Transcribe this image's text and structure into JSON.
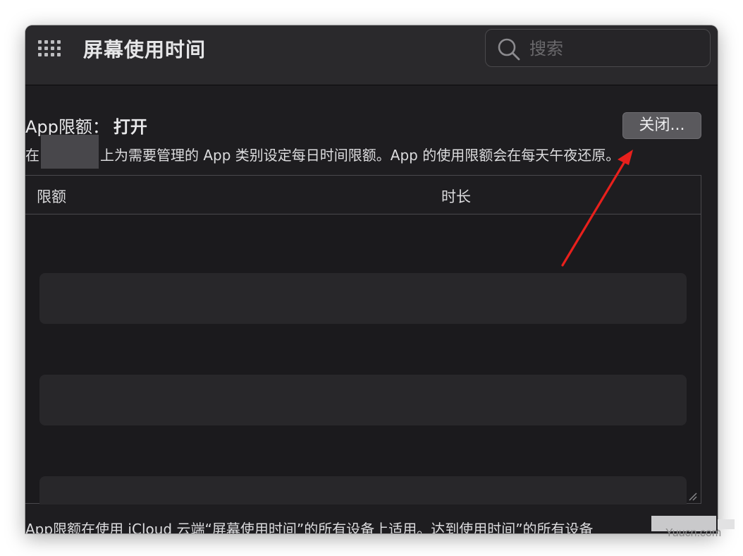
{
  "window": {
    "title": "屏幕使用时间",
    "search_placeholder": "搜索"
  },
  "app_limits": {
    "heading_label": "App限额：",
    "heading_state": "打开",
    "close_button": "关闭...",
    "description_prefix": "在",
    "description_rest": "上为需要管理的 App 类别设定每日时间限额。App 的使用限额会在每天午夜还原。"
  },
  "table": {
    "columns": [
      "限额",
      "时长"
    ]
  },
  "footer": {
    "text": "App限额在使用 iCloud 云端“屏幕使用时间”的所有设备上适用。达到使用时间”的所有设备"
  },
  "watermark": "Yuucn.com",
  "colors": {
    "window_bg": "#1e1d20",
    "titlebar_bg": "#2a292c",
    "button_bg": "#5a595d",
    "annotation_arrow": "#e8201c"
  },
  "icons": {
    "grid": "grid-icon",
    "search": "search-icon",
    "resize": "resize-grip-icon"
  }
}
